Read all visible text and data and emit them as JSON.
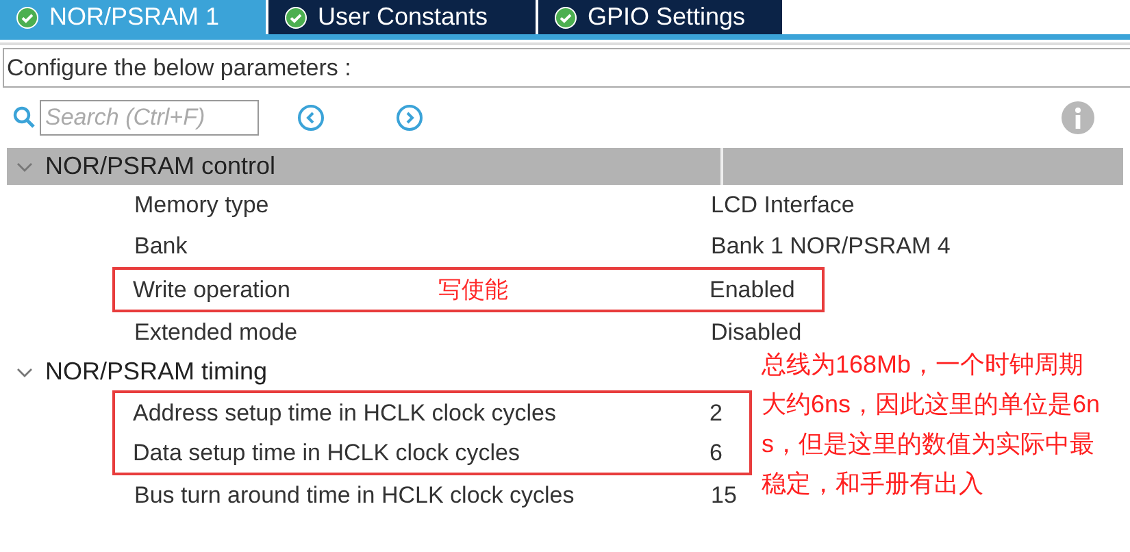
{
  "tabs": [
    {
      "label": "NOR/PSRAM 1",
      "selected": true
    },
    {
      "label": "User Constants",
      "selected": false
    },
    {
      "label": "GPIO Settings",
      "selected": false
    }
  ],
  "description": "Configure the below parameters :",
  "search": {
    "placeholder": "Search (Ctrl+F)"
  },
  "groups": [
    {
      "title": "NOR/PSRAM control",
      "expanded": true,
      "rows": [
        {
          "name": "Memory type",
          "value": "LCD Interface",
          "outlined": false
        },
        {
          "name": "Bank",
          "value": "Bank 1 NOR/PSRAM 4",
          "outlined": false
        },
        {
          "name": "Write operation",
          "value": "Enabled",
          "outlined": true,
          "note": "写使能"
        },
        {
          "name": "Extended mode",
          "value": "Disabled",
          "outlined": false
        }
      ]
    },
    {
      "title": "NOR/PSRAM timing",
      "expanded": true,
      "note": "总线为168Mb，一个时钟周期大约6ns，因此这里的单位是6ns，但是这里的数值为实际中最稳定，和手册有出入",
      "rows": [
        {
          "name": "Address setup time in HCLK clock cycles",
          "value": "2",
          "outlined": true
        },
        {
          "name": "Data setup time in HCLK clock cycles",
          "value": "6",
          "outlined": true
        },
        {
          "name": "Bus turn around time in HCLK clock cycles",
          "value": "15",
          "outlined": false
        }
      ]
    }
  ]
}
